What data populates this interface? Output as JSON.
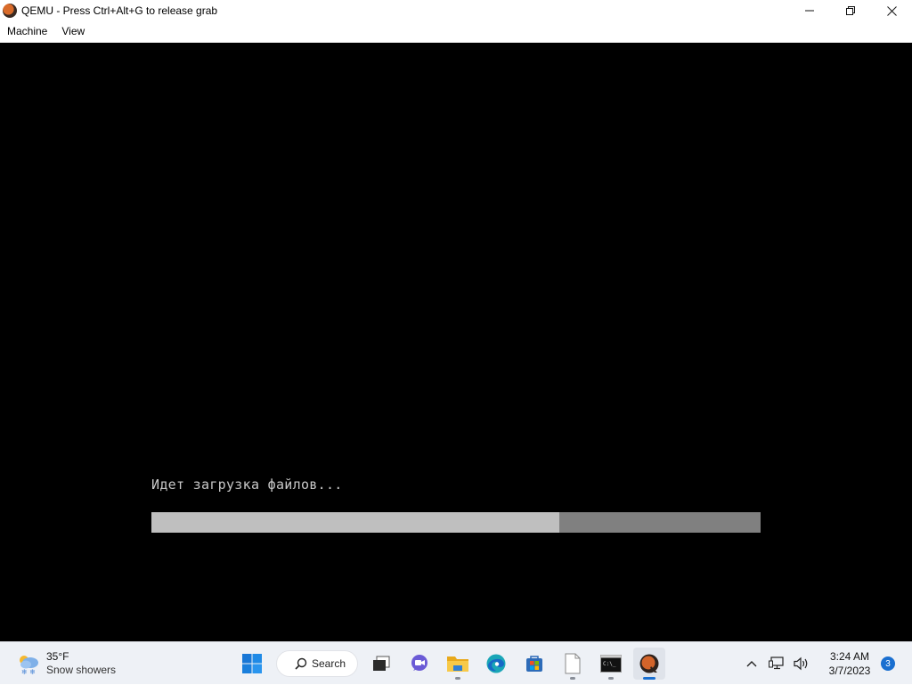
{
  "window": {
    "title": "QEMU - Press Ctrl+Alt+G to release grab",
    "icon": "qemu-logo-icon",
    "controls": [
      "minimize-icon",
      "restore-icon",
      "close-icon"
    ]
  },
  "menu": {
    "items": [
      {
        "label": "Machine"
      },
      {
        "label": "View"
      }
    ]
  },
  "guest": {
    "status_text": "Идет загрузка файлов...",
    "progress_fraction": 0.67,
    "colors": {
      "background": "#000000",
      "text": "#c8c8c8",
      "progress_fill": "#bfbfbf",
      "progress_track": "#808080"
    }
  },
  "taskbar": {
    "weather": {
      "temp": "35°F",
      "condition": "Snow showers",
      "icon": "snow-cloud-icon"
    },
    "search_label": "Search",
    "apps": [
      {
        "name": "start-button",
        "icon": "windows-logo-icon",
        "running": false,
        "active": false
      },
      {
        "name": "task-view-button",
        "icon": "task-view-icon",
        "running": false,
        "active": false
      },
      {
        "name": "teams-chat-button",
        "icon": "chat-icon",
        "running": false,
        "active": false
      },
      {
        "name": "file-explorer-button",
        "icon": "folder-icon",
        "running": true,
        "active": false
      },
      {
        "name": "edge-button",
        "icon": "edge-icon",
        "running": false,
        "active": false
      },
      {
        "name": "store-button",
        "icon": "store-icon",
        "running": false,
        "active": false
      },
      {
        "name": "notepad-button",
        "icon": "document-icon",
        "running": true,
        "active": false
      },
      {
        "name": "terminal-button",
        "icon": "terminal-icon",
        "running": true,
        "active": false
      },
      {
        "name": "qemu-button",
        "icon": "qemu-logo-icon",
        "running": true,
        "active": true
      }
    ],
    "tray": {
      "icons": [
        "chevron-up-icon",
        "network-icon",
        "volume-icon"
      ],
      "time": "3:24 AM",
      "date": "3/7/2023",
      "notification_count": "3"
    },
    "accent": "#1a6fd0"
  }
}
